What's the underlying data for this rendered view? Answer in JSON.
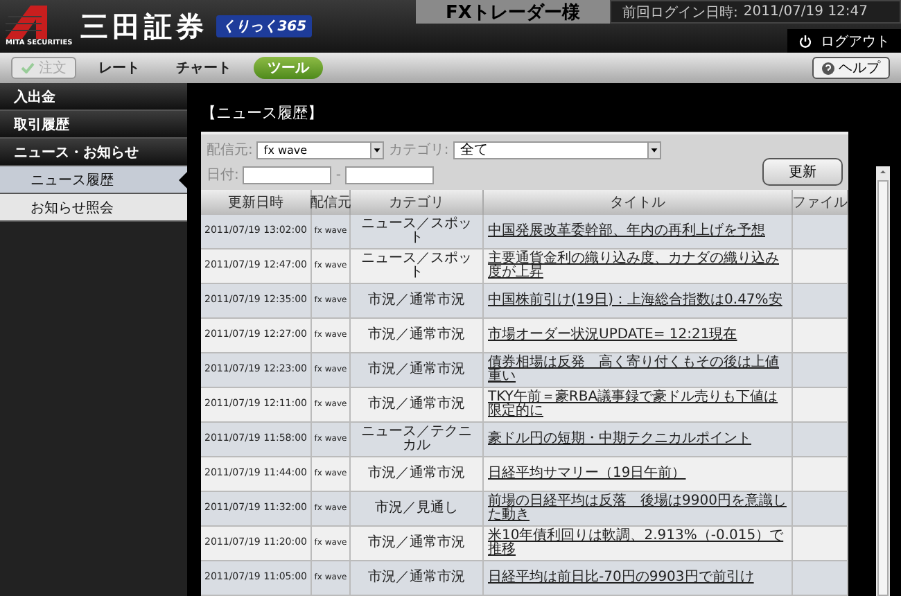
{
  "header": {
    "logo_sub": "MITA SECURITIES",
    "logo_name": "三田証券",
    "badge": "くりっく365",
    "user_title": "FXトレーダー様",
    "login_label": "前回ログイン日時:",
    "login_time": "2011/07/19 12:47",
    "logout": "ログアウト"
  },
  "toolbar": {
    "order_button": {
      "label": "注文",
      "disabled": true
    },
    "tabs": [
      {
        "label": "レート",
        "selected": false
      },
      {
        "label": "チャート",
        "selected": false
      },
      {
        "label": "ツール",
        "selected": true
      }
    ],
    "help": "ヘルプ"
  },
  "sidebar": {
    "items": [
      {
        "label": "入出金",
        "kind": "header",
        "selected": false
      },
      {
        "label": "取引履歴",
        "kind": "header",
        "selected": false
      },
      {
        "label": "ニュース・お知らせ",
        "kind": "header",
        "selected": false
      },
      {
        "label": "ニュース履歴",
        "kind": "sub",
        "selected": true
      },
      {
        "label": "お知らせ照会",
        "kind": "sub",
        "selected": false
      }
    ]
  },
  "page_title": "【ニュース履歴】",
  "filters": {
    "source_label": "配信元:",
    "source_value": "fx wave",
    "category_label": "カテゴリ:",
    "category_value": "全て",
    "date_label": "日付:",
    "date_separator": "-",
    "refresh": "更新"
  },
  "table": {
    "columns": [
      "更新日時",
      "配信元",
      "カテゴリ",
      "タイトル",
      "ファイル"
    ],
    "rows": [
      [
        "2011/07/19 13:02:00",
        "fx wave",
        "ニュース／スポット",
        "中国発展改革委幹部、年内の再利上げを予想"
      ],
      [
        "2011/07/19 12:47:00",
        "fx wave",
        "ニュース／スポット",
        "主要通貨金利の織り込み度、カナダの織り込み度が上昇"
      ],
      [
        "2011/07/19 12:35:00",
        "fx wave",
        "市況／通常市況",
        "中国株前引け(19日)：上海総合指数は0.47%安"
      ],
      [
        "2011/07/19 12:27:00",
        "fx wave",
        "市況／通常市況",
        "市場オーダー状況UPDATE= 12:21現在"
      ],
      [
        "2011/07/19 12:23:00",
        "fx wave",
        "市況／通常市況",
        "債券相場は反発　高く寄り付くもその後は上値重い"
      ],
      [
        "2011/07/19 12:11:00",
        "fx wave",
        "市況／通常市況",
        "TKY午前＝豪RBA議事録で豪ドル売りも下値は限定的に"
      ],
      [
        "2011/07/19 11:58:00",
        "fx wave",
        "ニュース／テクニカル",
        "豪ドル円の短期・中期テクニカルポイント"
      ],
      [
        "2011/07/19 11:44:00",
        "fx wave",
        "市況／通常市況",
        "日経平均サマリー（19日午前）"
      ],
      [
        "2011/07/19 11:32:00",
        "fx wave",
        "市況／見通し",
        "前場の日経平均は反落　後場は9900円を意識した動き"
      ],
      [
        "2011/07/19 11:20:00",
        "fx wave",
        "市況／通常市況",
        "米10年債利回りは軟調、2.913%（-0.015）で推移"
      ],
      [
        "2011/07/19 11:05:00",
        "fx wave",
        "市況／通常市況",
        "日経平均は前日比-70円の9903円で前引け"
      ]
    ]
  }
}
